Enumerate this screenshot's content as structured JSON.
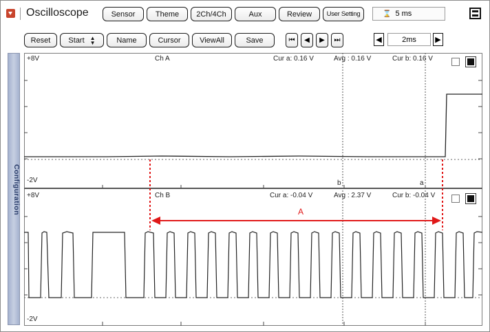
{
  "app": {
    "title": "Oscilloscope"
  },
  "toolbar": {
    "sensor": "Sensor",
    "theme": "Theme",
    "channels": "2Ch/4Ch",
    "aux": "Aux",
    "review": "Review",
    "user_setting": "User Setting",
    "timebase_display": "5 ms"
  },
  "controls": {
    "reset": "Reset",
    "start": "Start",
    "name": "Name",
    "cursor": "Cursor",
    "viewall": "ViewAll",
    "save": "Save",
    "timebase": "2ms"
  },
  "sidebar": {
    "label": "Configuration"
  },
  "channel_a": {
    "name": "Ch A",
    "top_scale": "+8V",
    "bottom_scale": "-2V",
    "cur_a": "Cur a: 0.16 V",
    "avg": "Avg  : 0.16 V",
    "cur_b": "Cur b: 0.16 V",
    "cursor_b_label": "b",
    "cursor_a_label": "a"
  },
  "channel_b": {
    "name": "Ch B",
    "top_scale": "+8V",
    "bottom_scale": "-2V",
    "cur_a": "Cur a: -0.04 V",
    "avg": "Avg  : 2.37 V",
    "cur_b": "Cur b: -0.04 V"
  },
  "annotation": {
    "label": "A",
    "color": "#e01818"
  },
  "colors": {
    "menu_icon": "#c8442c",
    "sidebar": "#a5b2cf",
    "annotation": "#e01818"
  }
}
